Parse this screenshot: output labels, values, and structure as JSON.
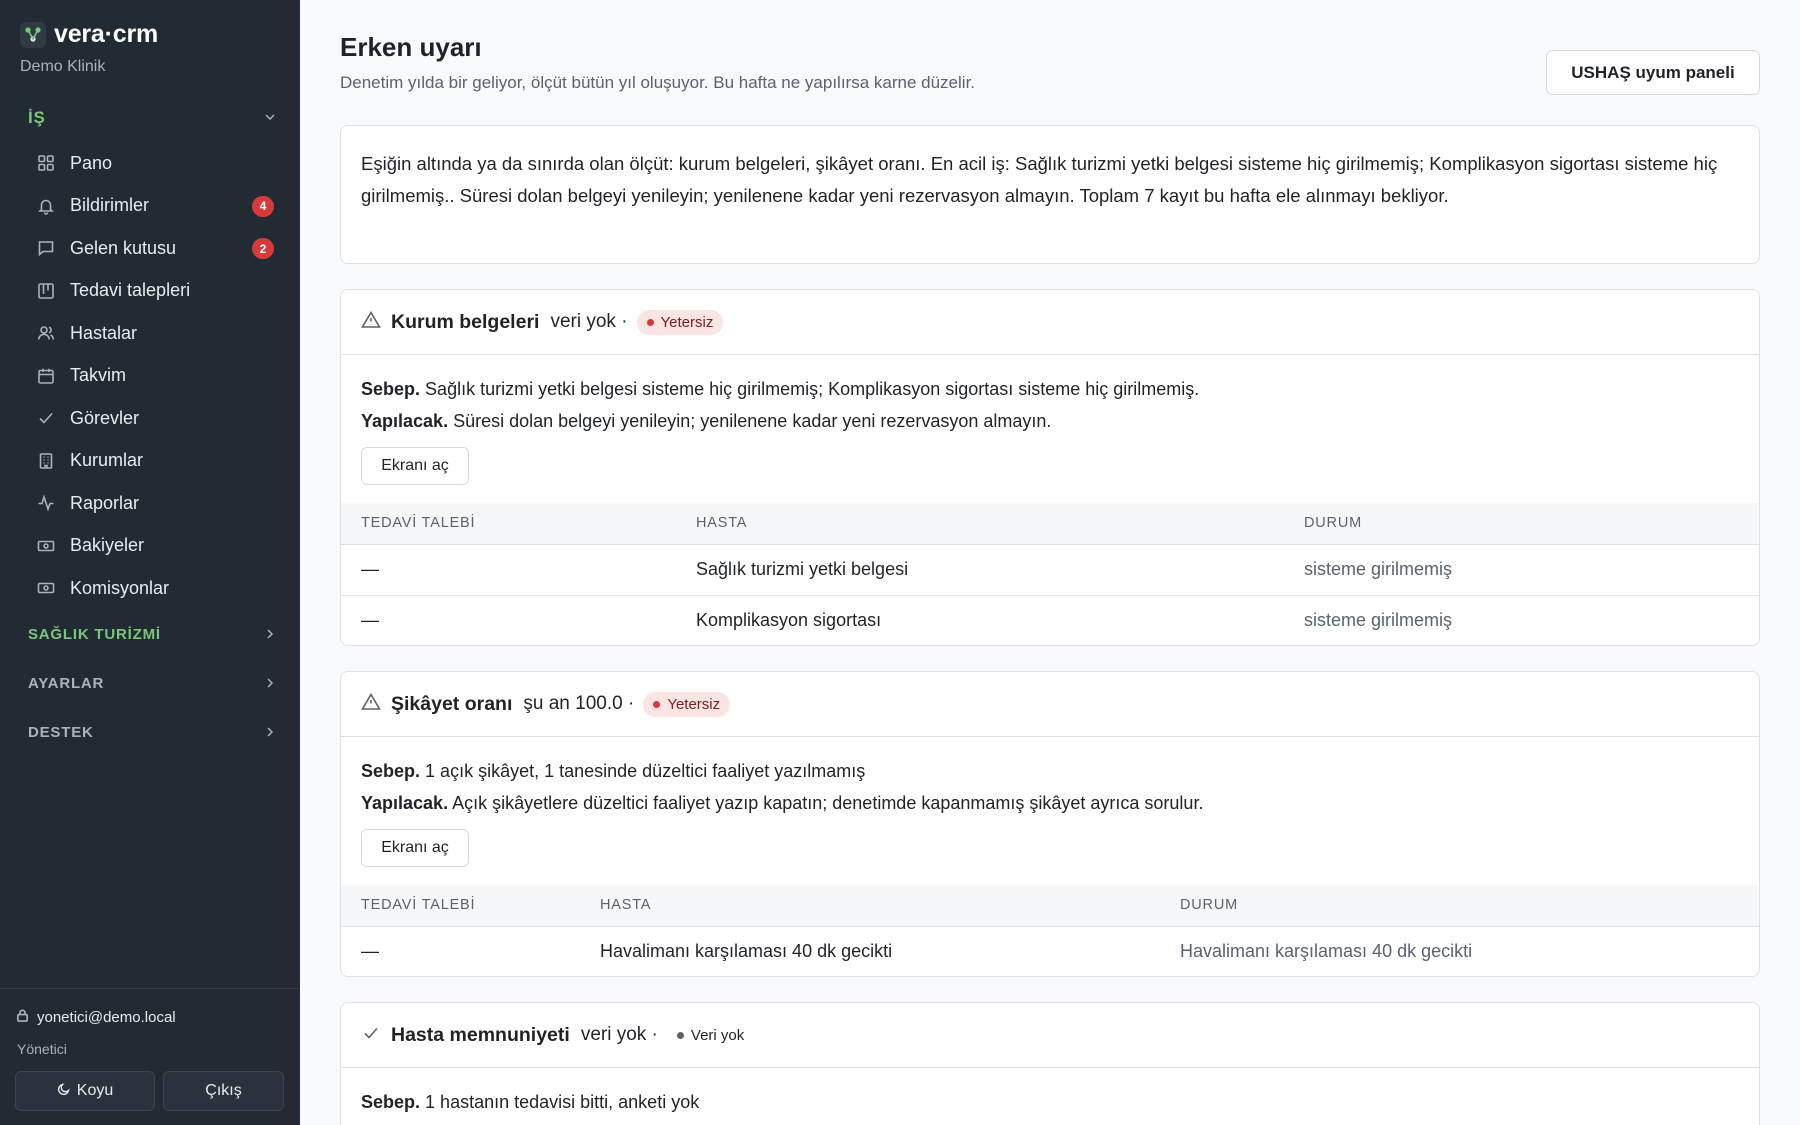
{
  "brand": {
    "name": "vera·crm",
    "subtitle": "Demo Klinik"
  },
  "sidebar": {
    "group_is": "İŞ",
    "items": [
      {
        "label": "Pano",
        "icon": "grid-icon"
      },
      {
        "label": "Bildirimler",
        "icon": "bell-icon",
        "badge": "4"
      },
      {
        "label": "Gelen kutusu",
        "icon": "message-icon",
        "badge": "2"
      },
      {
        "label": "Tedavi talepleri",
        "icon": "kanban-icon"
      },
      {
        "label": "Hastalar",
        "icon": "users-icon"
      },
      {
        "label": "Takvim",
        "icon": "calendar-icon"
      },
      {
        "label": "Görevler",
        "icon": "check-icon"
      },
      {
        "label": "Kurumlar",
        "icon": "building-icon"
      },
      {
        "label": "Raporlar",
        "icon": "activity-icon"
      },
      {
        "label": "Bakiyeler",
        "icon": "banknote-icon"
      },
      {
        "label": "Komisyonlar",
        "icon": "banknote-icon"
      }
    ],
    "group_saglik": "SAĞLIK TURİZMİ",
    "group_ayarlar": "AYARLAR",
    "group_destek": "DESTEK",
    "user_email": "yonetici@demo.local",
    "user_role": "Yönetici",
    "theme_button": "Koyu",
    "logout_button": "Çıkış"
  },
  "header": {
    "title": "Erken uyarı",
    "subtitle": "Denetim yılda bir geliyor, ölçüt bütün yıl oluşuyor. Bu hafta ne yapılırsa karne düzelir.",
    "panel_button": "USHAŞ uyum paneli"
  },
  "summary": "Eşiğin altında ya da sınırda olan ölçüt: kurum belgeleri, şikâyet oranı. En acil iş: Sağlık turizmi yetki belgesi sisteme hiç girilmemiş; Komplikasyon sigortası sisteme hiç girilmemiş.. Süresi dolan belgeyi yenileyin; yenilenene kadar yeni rezervasyon almayın. Toplam 7 kayıt bu hafta ele alınmayı bekliyor.",
  "cards": [
    {
      "title": "Kurum belgeleri",
      "value": "veri yok ·",
      "status": "Yetersiz",
      "reason_label": "Sebep.",
      "reason": "Sağlık turizmi yetki belgesi sisteme hiç girilmemiş; Komplikasyon sigortası sisteme hiç girilmemiş.",
      "action_label": "Yapılacak.",
      "action": "Süresi dolan belgeyi yenileyin; yenilenene kadar yeni rezervasyon almayın.",
      "open_button": "Ekranı aç",
      "columns": [
        "TEDAVİ TALEBİ",
        "HASTA",
        "DURUM"
      ],
      "rows": [
        [
          "—",
          "Sağlık turizmi yetki belgesi",
          "sisteme girilmemiş"
        ],
        [
          "—",
          "Komplikasyon sigortası",
          "sisteme girilmemiş"
        ]
      ]
    },
    {
      "title": "Şikâyet oranı",
      "value": "şu an 100.0 ·",
      "status": "Yetersiz",
      "reason_label": "Sebep.",
      "reason": "1 açık şikâyet, 1 tanesinde düzeltici faaliyet yazılmamış",
      "action_label": "Yapılacak.",
      "action": "Açık şikâyetlere düzeltici faaliyet yazıp kapatın; denetimde kapanmamış şikâyet ayrıca sorulur.",
      "open_button": "Ekranı aç",
      "columns": [
        "TEDAVİ TALEBİ",
        "HASTA",
        "DURUM"
      ],
      "rows": [
        [
          "—",
          "Havalimanı karşılaması 40 dk gecikti",
          "Havalimanı karşılaması 40 dk gecikti"
        ]
      ]
    },
    {
      "title": "Hasta memnuniyeti",
      "value": "veri yok ·",
      "status": "Veri yok",
      "reason_label": "Sebep.",
      "reason": "1 hastanın tedavisi bitti, anketi yok"
    }
  ]
}
